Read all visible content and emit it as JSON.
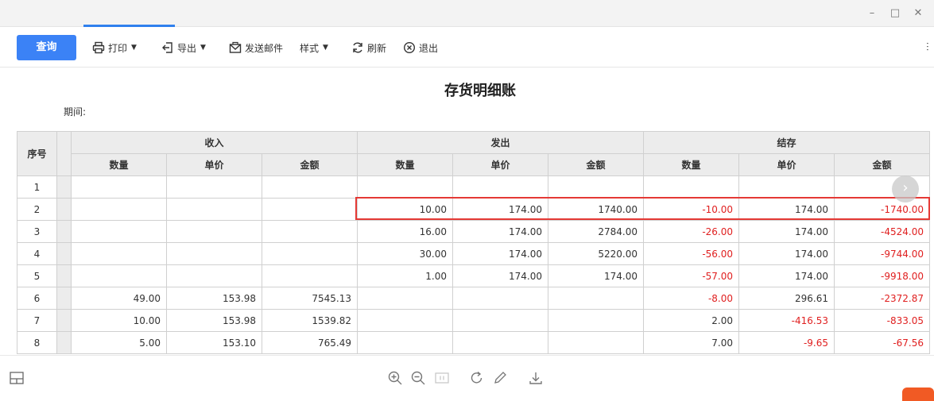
{
  "toolbar": {
    "query_label": "查询",
    "print_label": "打印",
    "export_label": "导出",
    "email_label": "发送邮件",
    "style_label": "样式",
    "refresh_label": "刷新",
    "exit_label": "退出"
  },
  "report": {
    "title": "存货明细账",
    "period_label": "期间:"
  },
  "table": {
    "col_index": "序号",
    "groups": {
      "in": "收入",
      "out": "发出",
      "bal": "结存"
    },
    "sub": {
      "qty": "数量",
      "price": "单价",
      "amount": "金额"
    },
    "rows": [
      {
        "idx": "1",
        "in_qty": "",
        "in_price": "",
        "in_amt": "",
        "out_qty": "",
        "out_price": "",
        "out_amt": "",
        "bal_qty": "",
        "bal_price": "",
        "bal_amt": ""
      },
      {
        "idx": "2",
        "in_qty": "",
        "in_price": "",
        "in_amt": "",
        "out_qty": "10.00",
        "out_price": "174.00",
        "out_amt": "1740.00",
        "bal_qty": "-10.00",
        "bal_price": "174.00",
        "bal_amt": "-1740.00"
      },
      {
        "idx": "3",
        "in_qty": "",
        "in_price": "",
        "in_amt": "",
        "out_qty": "16.00",
        "out_price": "174.00",
        "out_amt": "2784.00",
        "bal_qty": "-26.00",
        "bal_price": "174.00",
        "bal_amt": "-4524.00"
      },
      {
        "idx": "4",
        "in_qty": "",
        "in_price": "",
        "in_amt": "",
        "out_qty": "30.00",
        "out_price": "174.00",
        "out_amt": "5220.00",
        "bal_qty": "-56.00",
        "bal_price": "174.00",
        "bal_amt": "-9744.00"
      },
      {
        "idx": "5",
        "in_qty": "",
        "in_price": "",
        "in_amt": "",
        "out_qty": "1.00",
        "out_price": "174.00",
        "out_amt": "174.00",
        "bal_qty": "-57.00",
        "bal_price": "174.00",
        "bal_amt": "-9918.00"
      },
      {
        "idx": "6",
        "in_qty": "49.00",
        "in_price": "153.98",
        "in_amt": "7545.13",
        "out_qty": "",
        "out_price": "",
        "out_amt": "",
        "bal_qty": "-8.00",
        "bal_price": "296.61",
        "bal_amt": "-2372.87"
      },
      {
        "idx": "7",
        "in_qty": "10.00",
        "in_price": "153.98",
        "in_amt": "1539.82",
        "out_qty": "",
        "out_price": "",
        "out_amt": "",
        "bal_qty": "2.00",
        "bal_price": "-416.53",
        "bal_amt": "-833.05"
      },
      {
        "idx": "8",
        "in_qty": "5.00",
        "in_price": "153.10",
        "in_amt": "765.49",
        "out_qty": "",
        "out_price": "",
        "out_amt": "",
        "bal_qty": "7.00",
        "bal_price": "-9.65",
        "bal_amt": "-67.56"
      }
    ]
  },
  "colors": {
    "accent": "#3b82f6",
    "negative": "#e02020",
    "highlight": "#e53935"
  },
  "icons": {
    "print": "printer-icon",
    "export": "export-icon",
    "email": "envelope-icon",
    "refresh": "refresh-icon",
    "exit": "close-circle-icon",
    "zoom_in": "zoom-in-icon",
    "zoom_out": "zoom-out-icon",
    "fit": "fit-page-icon",
    "rotate": "rotate-icon",
    "edit": "pencil-icon",
    "download": "download-icon"
  }
}
